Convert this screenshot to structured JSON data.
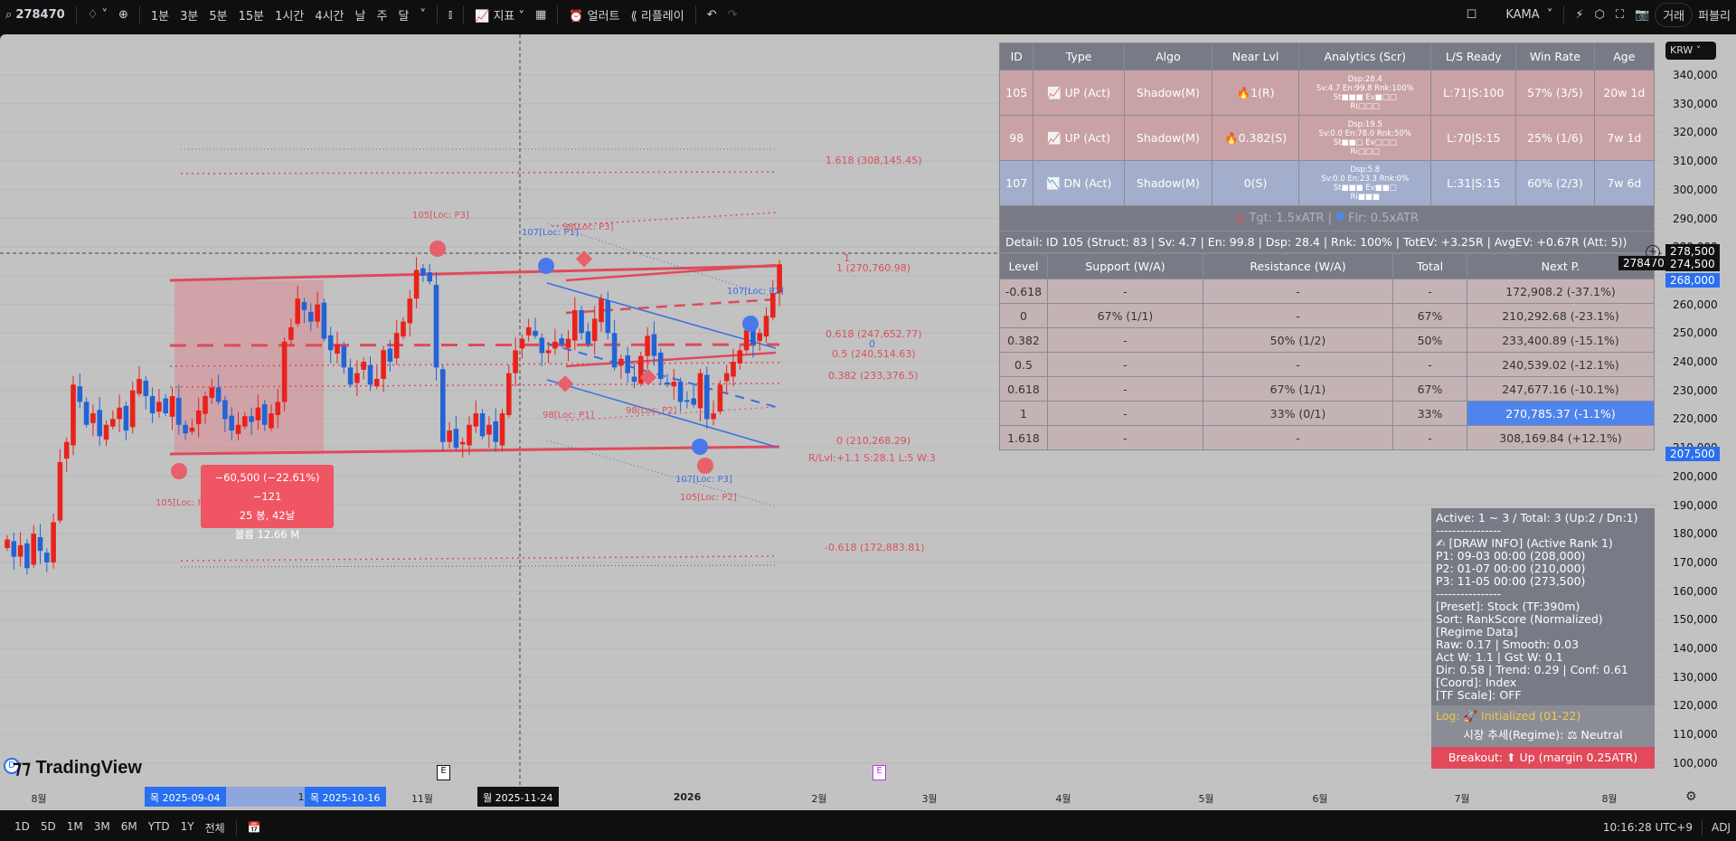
{
  "topbar": {
    "symbol": "278470",
    "intervals": [
      "1분",
      "3분",
      "5분",
      "15분",
      "1시간",
      "4시간",
      "날",
      "주",
      "달"
    ],
    "indicators": "지표",
    "alert": "얼러트",
    "replay": "리플레이",
    "indicator_name": "KAMA",
    "trade": "거래",
    "publish": "퍼블리"
  },
  "price_axis": {
    "currency": "KRW",
    "labels": [
      "340,000",
      "330,000",
      "320,000",
      "310,000",
      "300,000",
      "290,000",
      "280,000",
      "260,000",
      "250,000",
      "240,000",
      "230,000",
      "220,000",
      "210,000",
      "200,000",
      "190,000",
      "180,000",
      "170,000",
      "160,000",
      "150,000",
      "140,000",
      "130,000",
      "120,000",
      "110,000",
      "100,000"
    ],
    "crosshair_price": "278,500",
    "crosshair_tag": "278470",
    "last_price": "274,500",
    "current_price": "268,000",
    "low_tag": "207,500"
  },
  "time_axis": {
    "labels": [
      {
        "t": "8월"
      },
      {
        "t": "1"
      },
      {
        "t": "11월"
      },
      {
        "t": "2026"
      },
      {
        "t": "2월"
      },
      {
        "t": "3월"
      },
      {
        "t": "4월"
      },
      {
        "t": "5월"
      },
      {
        "t": "6월"
      },
      {
        "t": "7월"
      },
      {
        "t": "8월"
      }
    ],
    "range_start": "목 2025-09-04",
    "range_end": "목 2025-10-16",
    "crosshair_date": "월 2025-11-24"
  },
  "bottombar": {
    "ranges": [
      "1D",
      "5D",
      "1M",
      "3M",
      "6M",
      "YTD",
      "1Y",
      "전체"
    ],
    "clock": "10:16:28 UTC+9",
    "adj": "ADJ"
  },
  "chart_data": {
    "type": "candlestick",
    "closes": [
      178,
      172,
      176,
      168,
      180,
      174,
      170,
      184,
      205,
      212,
      232,
      226,
      218,
      222,
      214,
      218,
      220,
      224,
      216,
      230,
      234,
      228,
      222,
      226,
      222,
      228,
      218,
      215,
      217,
      223,
      228,
      231,
      226,
      220,
      216,
      218,
      221,
      219,
      224,
      218,
      222,
      226,
      247,
      252,
      262,
      258,
      254,
      260,
      248,
      244,
      246,
      238,
      232,
      236,
      240,
      232,
      234,
      244,
      240,
      250,
      254,
      262,
      272,
      270,
      268,
      238,
      212,
      216,
      210,
      212,
      218,
      222,
      214,
      218,
      212,
      222,
      236,
      244,
      248,
      252,
      249,
      243,
      244,
      247,
      246,
      248,
      258,
      250,
      246,
      255,
      262,
      250,
      238,
      241,
      236,
      233,
      242,
      249,
      242,
      234,
      232,
      233,
      226,
      226,
      225,
      236,
      220,
      222,
      232,
      236,
      240,
      244,
      251,
      246,
      250,
      256,
      264,
      274
    ],
    "unit": "thousand KRW",
    "up_color": "#e8221c",
    "down_color": "#2463d6"
  },
  "chart_labels": {
    "fib_1618": "1.618 (308,145.45)",
    "fib_1": "1 (270,760.98)",
    "fib_0618": "0.618 (247,652.77)",
    "fib_05": "0.5 (240,514.63)",
    "fib_0382": "0.382 (233,376.5)",
    "fib_0": "0 (210,268.29)",
    "fib_stats": "R/Lvl:+1.1 S:28.1 L:5 W:3",
    "fib_m0618": "-0.618 (172,883.81)",
    "p105_1": "105[Loc: P1]",
    "p105_2": "105[Loc: P2]",
    "p105_3": "105[Loc: P3]",
    "p107_1": "107[Loc: P1]",
    "p107_2": "107[Loc: P2]",
    "p107_3": "107[Loc: P3]",
    "p98_1": "98[Loc: P1]",
    "p98_2": "98[Loc: P2]",
    "p98_3": "98[Loc: P3]",
    "one": "1",
    "zero": "0"
  },
  "measure": {
    "line1": "−60,500 (−22.61%) −121",
    "line2": "25 봉, 42날",
    "line3": "볼륨 12.66 M"
  },
  "signals": {
    "headers": [
      "ID",
      "Type",
      "Algo",
      "Near Lvl",
      "Analytics (Scr)",
      "L/S Ready",
      "Win Rate",
      "Age"
    ],
    "rows": [
      {
        "id": "105",
        "type": "UP (Act)",
        "algo": "Shadow(M)",
        "near": "1(R)",
        "a1": "Dsp:28.4",
        "a2": "Sv:4.7 En:99.8 Rnk:100%",
        "a3": "St■■■ Ev■□□",
        "a4": "Ri□□□",
        "ls": "L:71|S:100",
        "win": "57% (3/5)",
        "age": "20w 1d",
        "dir": "up"
      },
      {
        "id": "98",
        "type": "UP (Act)",
        "algo": "Shadow(M)",
        "near": "0.382(S)",
        "a1": "Dsp:19.5",
        "a2": "Sv:0.0 En:78.0 Rnk:50%",
        "a3": "St■■□ Ev□□□",
        "a4": "Ri□□□",
        "ls": "L:70|S:15",
        "win": "25% (1/6)",
        "age": "7w 1d",
        "dir": "up"
      },
      {
        "id": "107",
        "type": "DN (Act)",
        "algo": "Shadow(M)",
        "near": "0(S)",
        "a1": "Dsp:5.8",
        "a2": "Sv:0.0 En:23.3 Rnk:0%",
        "a3": "St■■■ Ev■■□",
        "a4": "Ri■■■",
        "ls": "L:31|S:15",
        "win": "60% (2/3)",
        "age": "7w 6d",
        "dir": "dn"
      }
    ],
    "targets": "Tgt: 1.5xATR | ",
    "floor": "Flr: 0.5xATR",
    "detail": "Detail: ID 105 (Struct: 83 | Sv: 4.7 | En: 99.8 | Dsp: 28.4 | Rnk: 100% | TotEV: +3.25R | AvgEV: +0.67R (Att: 5))"
  },
  "levels": {
    "headers": [
      "Level",
      "Support (W/A)",
      "Resistance (W/A)",
      "Total",
      "Next P."
    ],
    "rows": [
      [
        "-0.618",
        "-",
        "-",
        "-",
        "172,908.2 (-37.1%)"
      ],
      [
        "0",
        "67% (1/1)",
        "-",
        "67%",
        "210,292.68 (-23.1%)"
      ],
      [
        "0.382",
        "-",
        "50% (1/2)",
        "50%",
        "233,400.89 (-15.1%)"
      ],
      [
        "0.5",
        "-",
        "-",
        "-",
        "240,539.02 (-12.1%)"
      ],
      [
        "0.618",
        "-",
        "67% (1/1)",
        "67%",
        "247,677.16 (-10.1%)"
      ],
      [
        "1",
        "-",
        "33% (0/1)",
        "33%",
        "270,785.37 (-1.1%)"
      ],
      [
        "1.618",
        "-",
        "-",
        "-",
        "308,169.84 (+12.1%)"
      ]
    ]
  },
  "info": {
    "body": "Active: 1 ~ 3 / Total: 3 (Up:2 / Dn:1)\n----------------\n✍ [DRAW INFO] (Active Rank 1)\nP1: 09-03 00:00 (208,000)\nP2: 01-07 00:00 (210,000)\nP3: 11-05 00:00 (273,500)\n----------------\n[Preset]: Stock (TF:390m)\nSort: RankScore (Normalized)\n[Regime Data]\nRaw: 0.17 | Smooth: 0.03\nAct W: 1.1 | Gst W: 0.1\nDir: 0.58 | Trend: 0.29 | Conf: 0.61\n[Coord]: Index\n[TF Scale]: OFF",
    "log": "Log: 🚀 Initialized (01-22)",
    "regime": "시장 추세(Regime): ⚖ Neutral",
    "breakout": "Breakout: ⬆ Up (margin 0.25ATR)"
  },
  "brand": {
    "name": "TradingView",
    "marker_e": "E",
    "marker_d": "D"
  }
}
